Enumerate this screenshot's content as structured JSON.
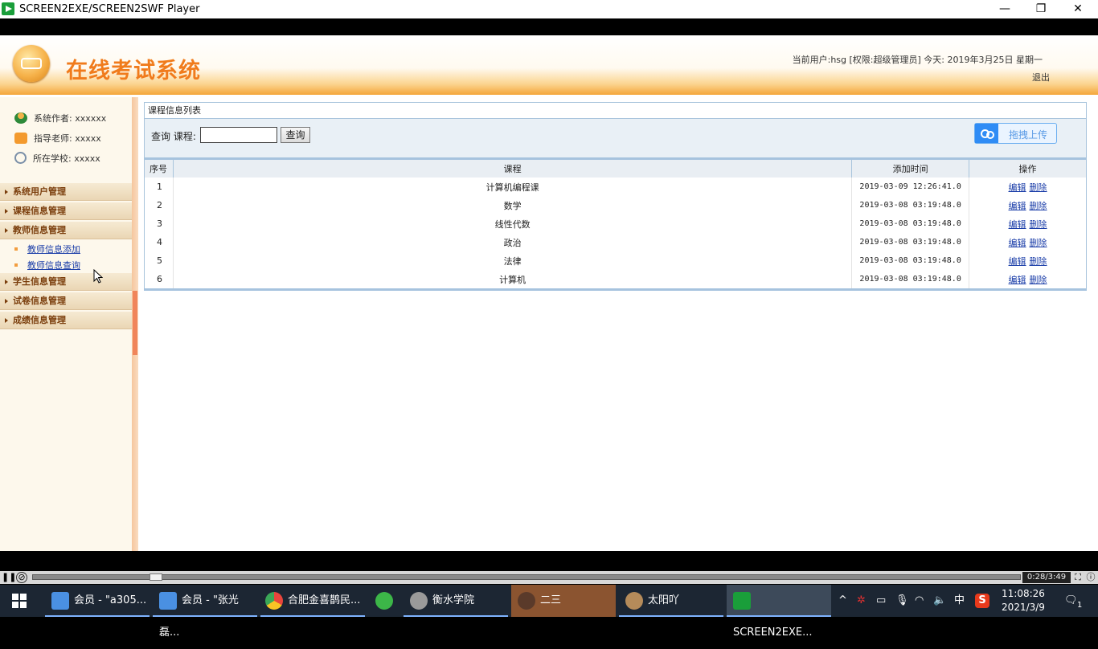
{
  "window": {
    "title": "SCREEN2EXE/SCREEN2SWF Player",
    "minimize": "—",
    "restore": "❐",
    "close": "✕"
  },
  "header": {
    "system_title": "在线考试系统",
    "user_info": "当前用户:hsg [权限:超级管理员] 今天: 2019年3月25日 星期一",
    "logout": "退出"
  },
  "sidebar": {
    "info": [
      {
        "label": "系统作者: xxxxxx"
      },
      {
        "label": "指导老师: xxxxx"
      },
      {
        "label": "所在学校: xxxxx"
      }
    ],
    "menus": [
      {
        "label": "系统用户管理"
      },
      {
        "label": "课程信息管理"
      },
      {
        "label": "教师信息管理"
      },
      {
        "label": "学生信息管理"
      },
      {
        "label": "试卷信息管理"
      },
      {
        "label": "成绩信息管理"
      }
    ],
    "submenus": [
      {
        "label": "教师信息添加"
      },
      {
        "label": "教师信息查询"
      }
    ]
  },
  "main": {
    "panel_title": "课程信息列表",
    "search_label": "查询 课程:",
    "search_value": "",
    "search_button": "查询",
    "upload_button": "拖拽上传",
    "columns": [
      "序号",
      "课程",
      "添加时间",
      "操作"
    ],
    "rows": [
      {
        "no": "1",
        "course": "计算机编程课",
        "time": "2019-03-09 12:26:41.0"
      },
      {
        "no": "2",
        "course": "数学",
        "time": "2019-03-08 03:19:48.0"
      },
      {
        "no": "3",
        "course": "线性代数",
        "time": "2019-03-08 03:19:48.0"
      },
      {
        "no": "4",
        "course": "政治",
        "time": "2019-03-08 03:19:48.0"
      },
      {
        "no": "5",
        "course": "法律",
        "time": "2019-03-08 03:19:48.0"
      },
      {
        "no": "6",
        "course": "计算机",
        "time": "2019-03-08 03:19:48.0"
      }
    ],
    "edit_label": "编辑",
    "delete_label": "删除"
  },
  "player": {
    "time": "0:28/3:49",
    "progress": 0.12
  },
  "taskbar": {
    "items": [
      {
        "label": "会员 - \"a305...",
        "icon": "cube-icon",
        "color": "#4a90e2"
      },
      {
        "label": "会员 - \"张光磊...",
        "icon": "cube-icon",
        "color": "#4a90e2"
      },
      {
        "label": "合肥金喜鹊民...",
        "icon": "chrome-icon",
        "color": "#e8453c"
      },
      {
        "label": "",
        "icon": "refresh-icon",
        "color": "#3cb648"
      },
      {
        "label": "衡水学院",
        "icon": "avatar-icon",
        "color": "#9a9a9a"
      },
      {
        "label": "二三",
        "icon": "avatar-icon",
        "color": "#c98a6a"
      },
      {
        "label": "太阳吖",
        "icon": "avatar-icon",
        "color": "#b58b5a"
      },
      {
        "label": "SCREEN2EXE...",
        "icon": "screen2exe-icon",
        "color": "#1a9e3a"
      }
    ],
    "tray": {
      "ime": "中"
    },
    "clock_time": "11:08:26",
    "clock_date": "2021/3/9",
    "notifications": "1"
  }
}
